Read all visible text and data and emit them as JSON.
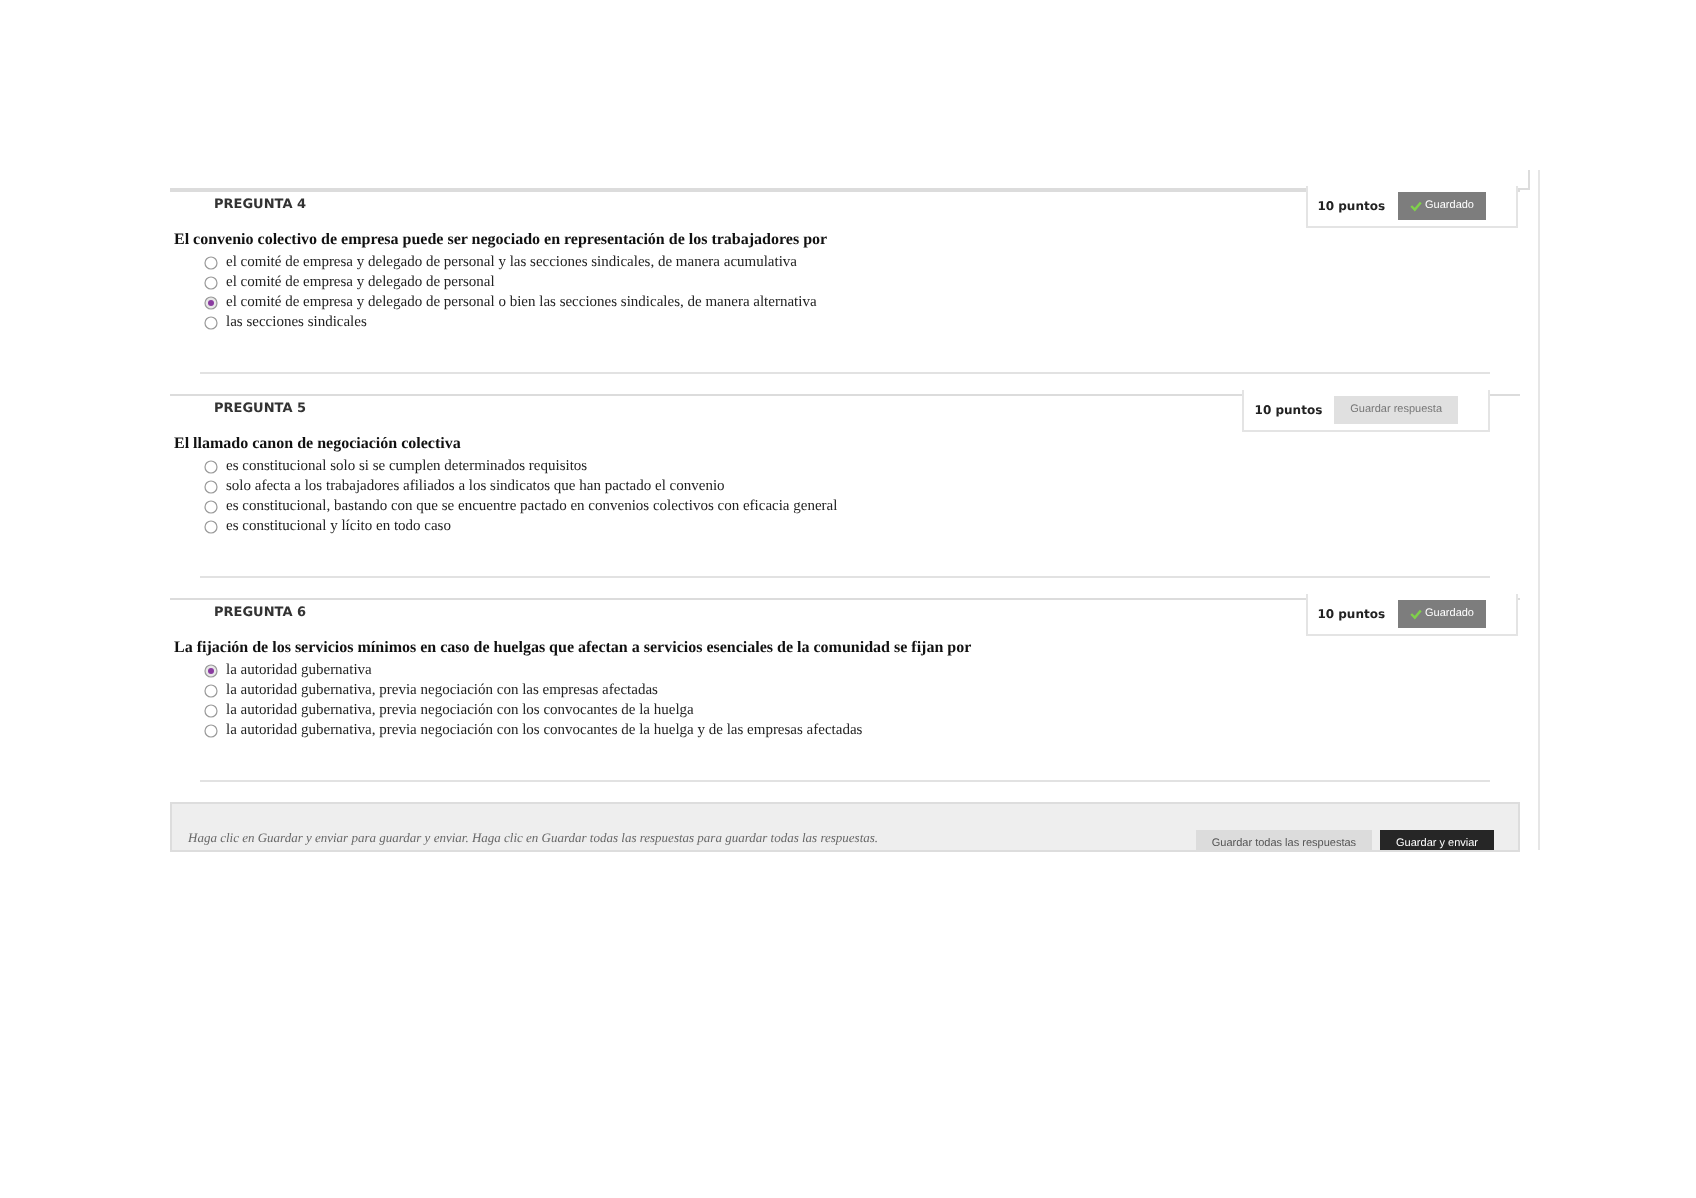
{
  "questions": [
    {
      "label": "PREGUNTA 4",
      "points": "10 puntos",
      "status": {
        "kind": "saved",
        "label": "Guardado"
      },
      "prompt": "El convenio colectivo de empresa puede ser negociado en representación de los trabajadores por",
      "options": [
        {
          "text": "el comité de empresa y delegado de personal y las secciones sindicales, de manera acumulativa",
          "selected": false
        },
        {
          "text": "el comité de empresa y delegado de personal",
          "selected": false
        },
        {
          "text": "el comité de empresa y delegado de personal o bien las secciones sindicales, de manera alternativa",
          "selected": true
        },
        {
          "text": "las secciones sindicales",
          "selected": false
        }
      ]
    },
    {
      "label": "PREGUNTA 5",
      "points": "10 puntos",
      "status": {
        "kind": "unsaved",
        "label": "Guardar respuesta"
      },
      "prompt": "El llamado canon de negociación colectiva",
      "options": [
        {
          "text": "es constitucional solo si se cumplen determinados requisitos",
          "selected": false
        },
        {
          "text": "solo afecta a los trabajadores afiliados a los sindicatos que han pactado el convenio",
          "selected": false
        },
        {
          "text": "es constitucional, bastando con que se encuentre pactado en convenios colectivos con eficacia general",
          "selected": false
        },
        {
          "text": "es constitucional y lícito en todo caso",
          "selected": false
        }
      ]
    },
    {
      "label": "PREGUNTA 6",
      "points": "10 puntos",
      "status": {
        "kind": "saved",
        "label": "Guardado"
      },
      "prompt": "La fijación de los servicios mínimos en caso de huelgas que afectan a servicios esenciales de la comunidad se fijan por",
      "options": [
        {
          "text": "la autoridad gubernativa",
          "selected": true
        },
        {
          "text": "la autoridad gubernativa, previa negociación con las empresas afectadas",
          "selected": false
        },
        {
          "text": "la autoridad gubernativa, previa negociación con los convocantes de la huelga",
          "selected": false
        },
        {
          "text": "la autoridad gubernativa, previa negociación con los convocantes de la huelga y de las empresas afectadas",
          "selected": false
        }
      ]
    }
  ],
  "footer": {
    "hint": "Haga clic en Guardar y enviar para guardar y enviar. Haga clic en Guardar todas las respuestas para guardar todas las respuestas.",
    "save_all": "Guardar todas las respuestas",
    "submit": "Guardar y enviar"
  }
}
